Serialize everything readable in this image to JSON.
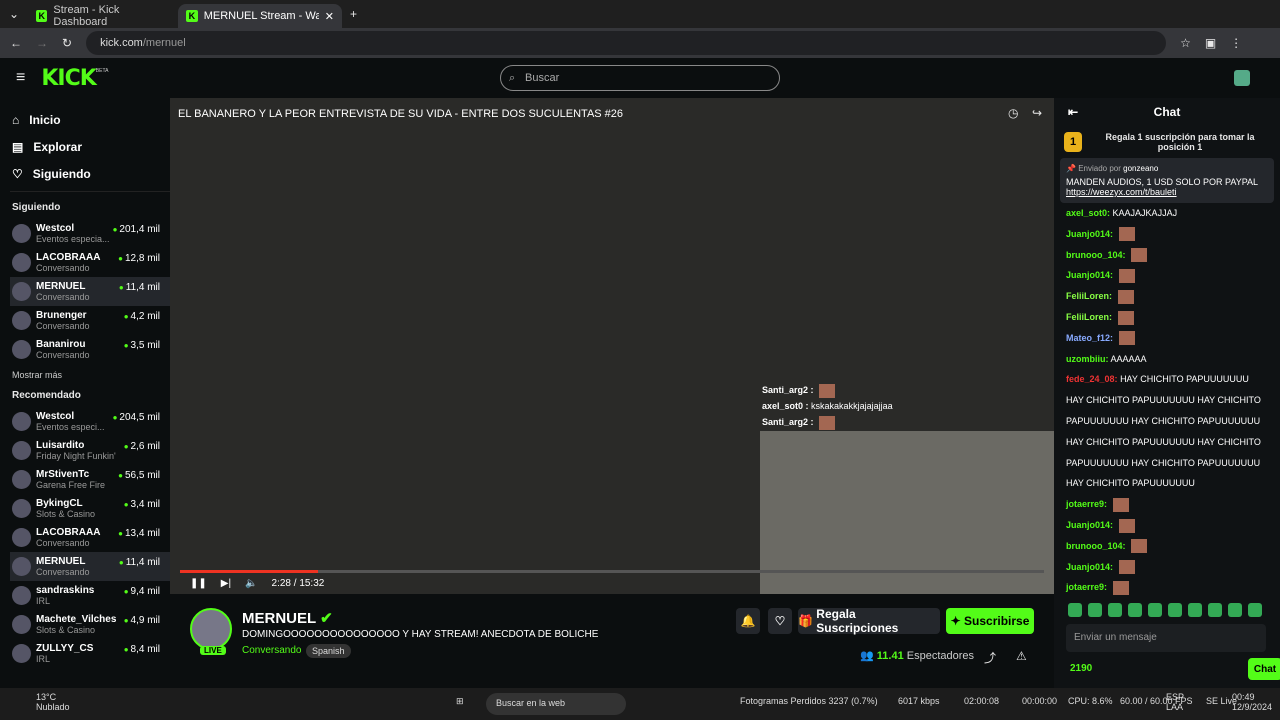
{
  "tabs": [
    {
      "label": "Stream - Kick Dashboard"
    },
    {
      "label": "MERNUEL Stream - Watch L..."
    }
  ],
  "address": {
    "host": "kick.com",
    "path": "/mernuel"
  },
  "header": {
    "logo": "KICK",
    "beta": "BETA",
    "search_placeholder": "Buscar"
  },
  "nav": {
    "home": "Inicio",
    "explore": "Explorar",
    "following": "Siguiendo"
  },
  "sidebar": {
    "following_title": "Siguiendo",
    "more": "Mostrar más",
    "recommended_title": "Recomendado",
    "following": [
      {
        "name": "Westcol",
        "cat": "Eventos especia...",
        "viewers": "201,4 mil"
      },
      {
        "name": "LACOBRAAA",
        "cat": "Conversando",
        "viewers": "12,8 mil"
      },
      {
        "name": "MERNUEL",
        "cat": "Conversando",
        "viewers": "11,4 mil"
      },
      {
        "name": "Brunenger",
        "cat": "Conversando",
        "viewers": "4,2 mil"
      },
      {
        "name": "Bananirou",
        "cat": "Conversando",
        "viewers": "3,5 mil"
      }
    ],
    "recommended": [
      {
        "name": "Westcol",
        "cat": "Eventos especi...",
        "viewers": "204,5 mil"
      },
      {
        "name": "Luisardito",
        "cat": "Friday Night Funkin'",
        "viewers": "2,6 mil"
      },
      {
        "name": "MrStivenTc",
        "cat": "Garena Free Fire",
        "viewers": "56,5 mil"
      },
      {
        "name": "BykingCL",
        "cat": "Slots & Casino",
        "viewers": "3,4 mil"
      },
      {
        "name": "LACOBRAAA",
        "cat": "Conversando",
        "viewers": "13,4 mil"
      },
      {
        "name": "MERNUEL",
        "cat": "Conversando",
        "viewers": "11,4 mil"
      },
      {
        "name": "sandraskins",
        "cat": "IRL",
        "viewers": "9,4 mil"
      },
      {
        "name": "Machete_Vilches",
        "cat": "Slots & Casino",
        "viewers": "4,9 mil"
      },
      {
        "name": "ZULLYY_CS",
        "cat": "IRL",
        "viewers": "8,4 mil"
      }
    ]
  },
  "video": {
    "title": "EL BANANERO Y LA PEOR ENTREVISTA DE SU VIDA - ENTRE DOS SUCULENTAS #26",
    "time": "2:28 / 15:32",
    "progress": 0.16,
    "pip_chat": [
      {
        "user": "Santi_arg2 :",
        "msg": ""
      },
      {
        "user": "axel_sot0 :",
        "msg": "kskakakakkjajajajjaa"
      },
      {
        "user": "Santi_arg2 :",
        "msg": ""
      }
    ]
  },
  "stream": {
    "name": "MERNUEL",
    "title": "DOMINGOOOOOOOOOOOOOOO Y HAY STREAM! ANECDOTA DE BOLICHE",
    "category": "Conversando",
    "language": "Spanish",
    "live": "LIVE",
    "gift_btn": "Regala Suscripciones",
    "sub_btn": "Suscribirse",
    "viewers": "11.4",
    "viewers_suffix": "1",
    "viewers_label": "Espectadores"
  },
  "chat": {
    "title": "Chat",
    "gift_text": "Regala 1 suscripción para tomar la posición 1",
    "gift_rank": "1",
    "pinned_by_label": "Enviado por",
    "pinned_by": "gonzeano",
    "pinned_text": "MANDEN AUDIOS, 1 USD SOLO POR PAYPAL",
    "pinned_link": "https://weezyx.com/t/bauleti",
    "messages": [
      {
        "user": "axel_sot0:",
        "text": "KAAJAJKAJJAJ"
      },
      {
        "user": "Juanjo014:",
        "text": ""
      },
      {
        "user": "brunooo_104:",
        "text": ""
      },
      {
        "user": "Juanjo014:",
        "text": ""
      },
      {
        "user": "FeliiLoren:",
        "text": ""
      },
      {
        "user": "FeliiLoren:",
        "text": ""
      },
      {
        "user": "Mateo_f12:",
        "text": ""
      },
      {
        "user": "uzombiiu:",
        "text": "AAAAAA"
      },
      {
        "user": "fede_24_08:",
        "text": "HAY CHICHITO PAPUUUUUUU HAY CHICHITO PAPUUUUUUU HAY CHICHITO PAPUUUUUUU HAY CHICHITO PAPUUUUUUU HAY CHICHITO PAPUUUUUUU HAY CHICHITO PAPUUUUUUU HAY CHICHITO PAPUUUUUUU HAY CHICHITO PAPUUUUUUU"
      },
      {
        "user": "jotaerre9:",
        "text": ""
      },
      {
        "user": "Juanjo014:",
        "text": ""
      },
      {
        "user": "brunooo_104:",
        "text": ""
      },
      {
        "user": "Juanjo014:",
        "text": ""
      },
      {
        "user": "jotaerre9:",
        "text": ""
      }
    ],
    "input_placeholder": "Enviar un mensaje",
    "points": "2190",
    "send": "Chat"
  },
  "taskbar": {
    "temp": "13°C",
    "weather": "Nublado",
    "search": "Buscar en la web",
    "obs_frames": "Fotogramas Perdidos 3237 (0.7%)",
    "kbps": "6017 kbps",
    "rec": "02:00:08",
    "rec2": "00:00:00",
    "cpu": "CPU: 8.6%",
    "fps": "60.00 / 60.00 FPS",
    "live": "SE Live",
    "lang": "ESP",
    "lang2": "LAA",
    "time": "00:49",
    "date": "12/9/2024"
  }
}
